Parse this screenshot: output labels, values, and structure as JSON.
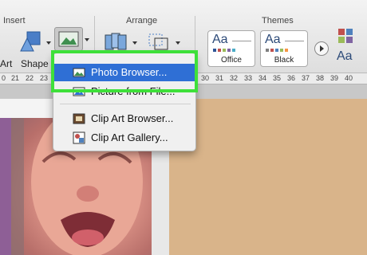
{
  "ribbon": {
    "groups": {
      "insert": "Insert",
      "arrange": "Arrange",
      "themes": "Themes"
    },
    "tools": {
      "art_partial": "Art",
      "shape": "Shape"
    },
    "themes": [
      {
        "name": "Office",
        "preview": "Aa",
        "swatches": [
          "#2f5597",
          "#c0504d",
          "#9bbb59",
          "#8064a2",
          "#4bacc6"
        ]
      },
      {
        "name": "Black",
        "preview": "Aa",
        "swatches": [
          "#7f7f7f",
          "#c0504d",
          "#4f81bd",
          "#9bbb59",
          "#f79646"
        ]
      }
    ],
    "font_theme": "Aa"
  },
  "ruler": {
    "ticks": [
      "0",
      "21",
      "22",
      "23",
      "30",
      "31",
      "32",
      "33",
      "34",
      "35",
      "36",
      "37",
      "38",
      "39",
      "40"
    ]
  },
  "menu": {
    "items": [
      {
        "label": "Photo Browser...",
        "icon": "photo-browser-icon",
        "selected": true
      },
      {
        "label": "Picture from File...",
        "icon": "picture-file-icon",
        "selected": false
      },
      {
        "label": "Clip Art Browser...",
        "icon": "clip-art-browser-icon",
        "selected": false
      },
      {
        "label": "Clip Art Gallery...",
        "icon": "clip-art-gallery-icon",
        "selected": false
      }
    ]
  },
  "colors": {
    "selection": "#2f6fd5",
    "highlight": "#3ee03a",
    "ribbon": "#e6e6e6"
  }
}
